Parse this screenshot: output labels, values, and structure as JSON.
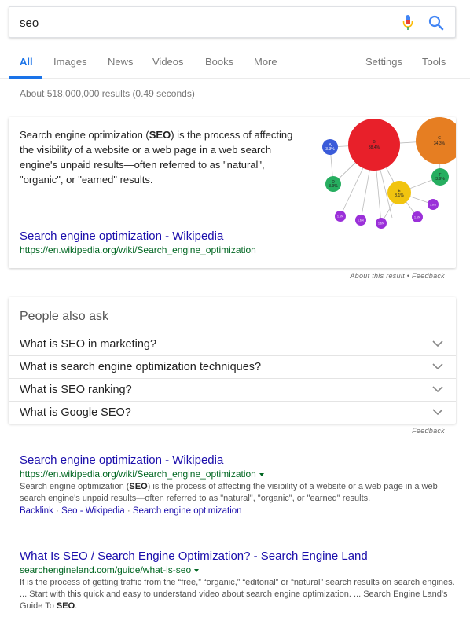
{
  "search": {
    "query": "seo"
  },
  "tabs": {
    "all": "All",
    "images": "Images",
    "news": "News",
    "videos": "Videos",
    "books": "Books",
    "more": "More",
    "settings": "Settings",
    "tools": "Tools"
  },
  "stats": "About 518,000,000 results (0.49 seconds)",
  "snippet": {
    "text_before": "Search engine optimization (",
    "text_bold": "SEO",
    "text_after": ") is the process of affecting the visibility of a website or a web page in a web search engine's unpaid results—often referred to as \"natural\", \"organic\", or \"earned\" results.",
    "link_title": "Search engine optimization - Wikipedia",
    "url": "https://en.wikipedia.org/wiki/Search_engine_optimization",
    "graph_labels": {
      "b": "B",
      "b_pct": "38.4%",
      "c": "C",
      "c_pct": "34.3%",
      "a": "A",
      "a_pct": "3.3%",
      "d": "D",
      "d_pct": "3.9%",
      "e": "E",
      "e_pct": "8.1%",
      "f": "F",
      "f_pct": "3.9%",
      "small": "1.6%"
    },
    "colors": {
      "red": "#e8202a",
      "orange": "#e67e22",
      "yellow": "#f1c40f",
      "green": "#27ae60",
      "blue": "#3b5bd9",
      "purple": "#9b30d9"
    }
  },
  "about_line": "About this result • Feedback",
  "paa": {
    "title": "People also ask",
    "questions": [
      "What is SEO in marketing?",
      "What is search engine optimization techniques?",
      "What is SEO ranking?",
      "What is Google SEO?"
    ],
    "feedback": "Feedback"
  },
  "results": [
    {
      "title": "Search engine optimization - Wikipedia",
      "url": "https://en.wikipedia.org/wiki/Search_engine_optimization",
      "desc_before": "Search engine optimization (",
      "desc_bold": "SEO",
      "desc_after": ") is the process of affecting the visibility of a website or a web page in a web search engine's unpaid results—often referred to as \"natural\", \"organic\", or \"earned\" results.",
      "sitelinks": [
        "Backlink",
        "Seo - Wikipedia",
        "Search engine optimization"
      ]
    },
    {
      "title": "What Is SEO / Search Engine Optimization? - Search Engine Land",
      "url": "searchengineland.com/guide/what-is-seo",
      "desc_before": "It is the process of getting traffic from the “free,” “organic,” “editorial” or “natural” search results on search engines. ... Start with this quick and easy to understand video about search engine optimization. ... Search Engine Land's Guide To ",
      "desc_bold": "SEO",
      "desc_after": "."
    }
  ]
}
